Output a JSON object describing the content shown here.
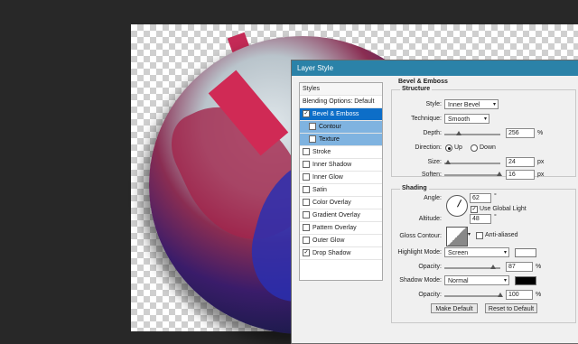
{
  "dialog": {
    "title": "Layer Style"
  },
  "styles_list": [
    {
      "label": "Styles",
      "checkbox": false,
      "checked": false,
      "state": "head"
    },
    {
      "label": "Blending Options: Default",
      "checkbox": false,
      "checked": false,
      "state": "normal"
    },
    {
      "label": "Bevel & Emboss",
      "checkbox": true,
      "checked": true,
      "state": "selected"
    },
    {
      "label": "Contour",
      "checkbox": true,
      "checked": false,
      "state": "sub"
    },
    {
      "label": "Texture",
      "checkbox": true,
      "checked": false,
      "state": "sub"
    },
    {
      "label": "Stroke",
      "checkbox": true,
      "checked": false,
      "state": "normal"
    },
    {
      "label": "Inner Shadow",
      "checkbox": true,
      "checked": false,
      "state": "normal"
    },
    {
      "label": "Inner Glow",
      "checkbox": true,
      "checked": false,
      "state": "normal"
    },
    {
      "label": "Satin",
      "checkbox": true,
      "checked": false,
      "state": "normal"
    },
    {
      "label": "Color Overlay",
      "checkbox": true,
      "checked": false,
      "state": "normal"
    },
    {
      "label": "Gradient Overlay",
      "checkbox": true,
      "checked": false,
      "state": "normal"
    },
    {
      "label": "Pattern Overlay",
      "checkbox": true,
      "checked": false,
      "state": "normal"
    },
    {
      "label": "Outer Glow",
      "checkbox": true,
      "checked": false,
      "state": "normal"
    },
    {
      "label": "Drop Shadow",
      "checkbox": true,
      "checked": true,
      "state": "normal"
    }
  ],
  "bevel": {
    "section_title": "Bevel & Emboss",
    "structure_title": "Structure",
    "style_label": "Style:",
    "style_value": "Inner Bevel",
    "technique_label": "Technique:",
    "technique_value": "Smooth",
    "depth_label": "Depth:",
    "depth_value": "256",
    "depth_unit": "%",
    "depth_level": 0.25,
    "direction_label": "Direction:",
    "direction_up": "Up",
    "direction_down": "Down",
    "size_label": "Size:",
    "size_value": "24",
    "size_unit": "px",
    "size_level": 0.06,
    "soften_label": "Soften:",
    "soften_value": "16",
    "soften_unit": "px",
    "soften_level": 0.98
  },
  "shading": {
    "title": "Shading",
    "angle_label": "Angle:",
    "angle_value": "62",
    "angle_unit": "°",
    "use_global_light": "Use Global Light",
    "altitude_label": "Altitude:",
    "altitude_value": "48",
    "altitude_unit": "°",
    "gloss_label": "Gloss Contour:",
    "anti_aliased": "Anti-aliased",
    "highlight_mode_label": "Highlight Mode:",
    "highlight_mode_value": "Screen",
    "highlight_color": "#ffffff",
    "highlight_opacity_label": "Opacity:",
    "highlight_opacity_value": "87",
    "highlight_opacity_unit": "%",
    "highlight_opacity_level": 0.87,
    "shadow_mode_label": "Shadow Mode:",
    "shadow_mode_value": "Normal",
    "shadow_color": "#000000",
    "shadow_opacity_label": "Opacity:",
    "shadow_opacity_value": "100",
    "shadow_opacity_unit": "%",
    "shadow_opacity_level": 1.0
  },
  "buttons": {
    "make_default": "Make Default",
    "reset_default": "Reset to Default"
  }
}
